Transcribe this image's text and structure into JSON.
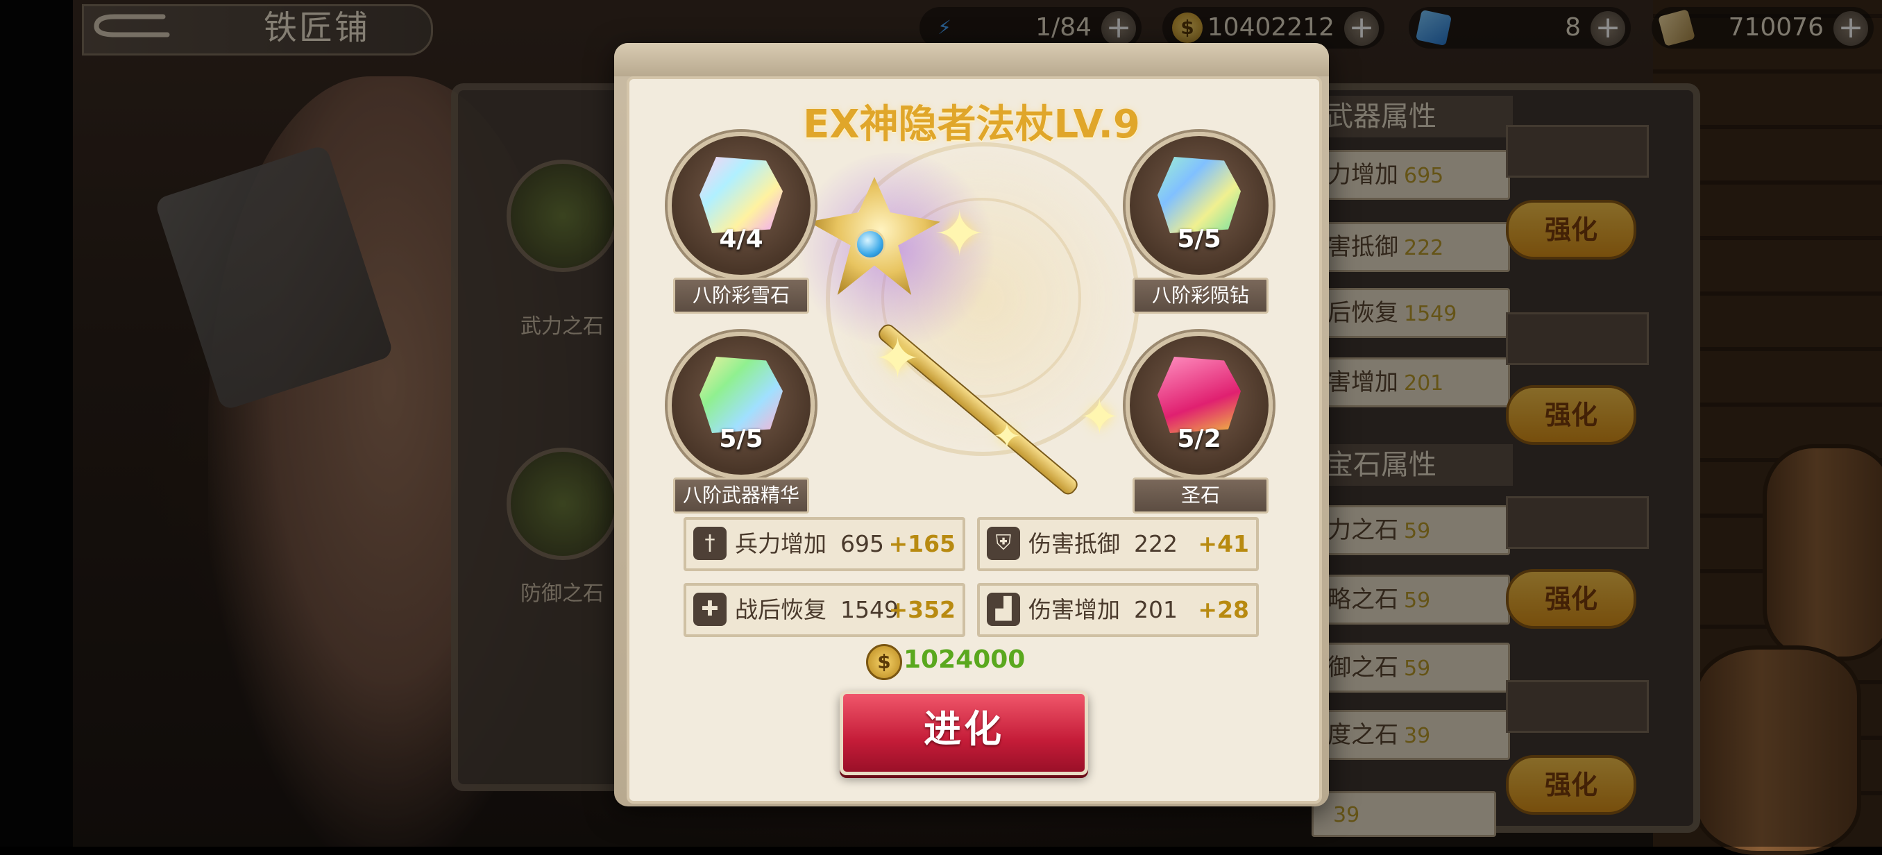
{
  "header": {
    "title": "铁匠铺",
    "back_icon": "back-arrow-icon"
  },
  "resources": [
    {
      "icon": "lightning-icon",
      "value": "1/84",
      "color": "#4aa8ff"
    },
    {
      "icon": "gold-coin-icon",
      "value": "10402212",
      "color": "#e0b43a"
    },
    {
      "icon": "blue-ticket-icon",
      "value": "8",
      "color": "#3a9ae8"
    },
    {
      "icon": "scroll-icon",
      "value": "710076",
      "color": "#d8b870"
    }
  ],
  "background": {
    "left_items": [
      "武力之石",
      "防御之石"
    ],
    "right_sections": {
      "weapon_header": "武器属性",
      "gem_header": "宝石属性",
      "weapon_rows": [
        {
          "label": "力增加",
          "value": "695"
        },
        {
          "label": "害抵御",
          "value": "222"
        },
        {
          "label": "后恢复",
          "value": "1549"
        },
        {
          "label": "害增加",
          "value": "201"
        }
      ],
      "gem_rows": [
        {
          "label": "力之石",
          "value": "59"
        },
        {
          "label": "略之石",
          "value": "59"
        },
        {
          "label": "御之石",
          "value": "59"
        },
        {
          "label": "度之石",
          "value": "39"
        }
      ],
      "strengthen_label": "强化",
      "partial_values": [
        "39",
        "39"
      ]
    }
  },
  "modal": {
    "title": "EX神隐者法杖LV.9",
    "materials": [
      {
        "name": "八阶彩雪石",
        "count": "4/4",
        "color": "#e8a0f0"
      },
      {
        "name": "八阶彩陨钻",
        "count": "5/5",
        "color": "#88e0c0"
      },
      {
        "name": "八阶武器精华",
        "count": "5/5",
        "color": "#b0e890"
      },
      {
        "name": "圣石",
        "count": "5/2",
        "color": "#f04888"
      }
    ],
    "stats": [
      {
        "icon": "sword-icon",
        "name": "兵力增加",
        "value": "695",
        "bonus": "+165"
      },
      {
        "icon": "shield-icon",
        "name": "伤害抵御",
        "value": "222",
        "bonus": "+41"
      },
      {
        "icon": "recovery-icon",
        "name": "战后恢复",
        "value": "1549",
        "bonus": "+352"
      },
      {
        "icon": "boot-icon",
        "name": "伤害增加",
        "value": "201",
        "bonus": "+28"
      }
    ],
    "cost": "1024000",
    "evolve_label": "进化"
  }
}
